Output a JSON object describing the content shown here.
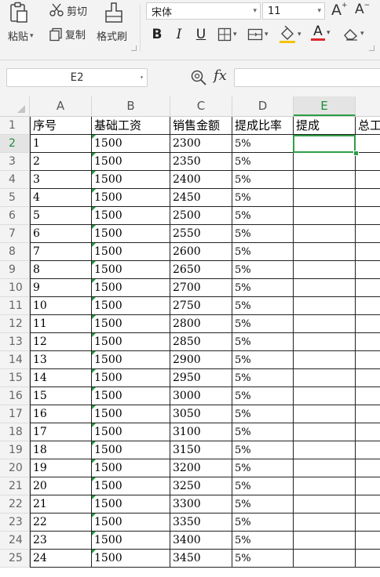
{
  "toolbar": {
    "cut_label": "剪切",
    "paste_label": "粘贴",
    "copy_label": "复制",
    "format_painter_label": "格式刷",
    "font_name": "宋体",
    "font_size": "11",
    "bold_label": "B",
    "italic_label": "I",
    "underline_label": "U",
    "grow_font_label": "A",
    "shrink_font_label": "A",
    "font_color_label": "A",
    "accent_color": "#e0282e",
    "fill_color": "#f2c300"
  },
  "formula_bar": {
    "name_box": "E2",
    "fx_label": "fx",
    "formula_value": ""
  },
  "sheet": {
    "columns": [
      "A",
      "B",
      "C",
      "D",
      "E",
      ""
    ],
    "selected_column": "E",
    "selected_row": "2",
    "header_row": [
      "序号",
      "基础工资",
      "销售金额",
      "提成比率",
      "提成",
      "总工"
    ],
    "rows": [
      {
        "row": "2",
        "a": "1",
        "b": "1500",
        "c": "2300",
        "d": "5%"
      },
      {
        "row": "3",
        "a": "2",
        "b": "1500",
        "c": "2350",
        "d": "5%"
      },
      {
        "row": "4",
        "a": "3",
        "b": "1500",
        "c": "2400",
        "d": "5%"
      },
      {
        "row": "5",
        "a": "4",
        "b": "1500",
        "c": "2450",
        "d": "5%"
      },
      {
        "row": "6",
        "a": "5",
        "b": "1500",
        "c": "2500",
        "d": "5%"
      },
      {
        "row": "7",
        "a": "6",
        "b": "1500",
        "c": "2550",
        "d": "5%"
      },
      {
        "row": "8",
        "a": "7",
        "b": "1500",
        "c": "2600",
        "d": "5%"
      },
      {
        "row": "9",
        "a": "8",
        "b": "1500",
        "c": "2650",
        "d": "5%"
      },
      {
        "row": "10",
        "a": "9",
        "b": "1500",
        "c": "2700",
        "d": "5%"
      },
      {
        "row": "11",
        "a": "10",
        "b": "1500",
        "c": "2750",
        "d": "5%"
      },
      {
        "row": "12",
        "a": "11",
        "b": "1500",
        "c": "2800",
        "d": "5%"
      },
      {
        "row": "13",
        "a": "12",
        "b": "1500",
        "c": "2850",
        "d": "5%"
      },
      {
        "row": "14",
        "a": "13",
        "b": "1500",
        "c": "2900",
        "d": "5%"
      },
      {
        "row": "15",
        "a": "14",
        "b": "1500",
        "c": "2950",
        "d": "5%"
      },
      {
        "row": "16",
        "a": "15",
        "b": "1500",
        "c": "3000",
        "d": "5%"
      },
      {
        "row": "17",
        "a": "16",
        "b": "1500",
        "c": "3050",
        "d": "5%"
      },
      {
        "row": "18",
        "a": "17",
        "b": "1500",
        "c": "3100",
        "d": "5%"
      },
      {
        "row": "19",
        "a": "18",
        "b": "1500",
        "c": "3150",
        "d": "5%"
      },
      {
        "row": "20",
        "a": "19",
        "b": "1500",
        "c": "3200",
        "d": "5%"
      },
      {
        "row": "21",
        "a": "20",
        "b": "1500",
        "c": "3250",
        "d": "5%"
      },
      {
        "row": "22",
        "a": "21",
        "b": "1500",
        "c": "3300",
        "d": "5%"
      },
      {
        "row": "23",
        "a": "22",
        "b": "1500",
        "c": "3350",
        "d": "5%"
      },
      {
        "row": "24",
        "a": "23",
        "b": "1500",
        "c": "3400",
        "d": "5%"
      },
      {
        "row": "25",
        "a": "24",
        "b": "1500",
        "c": "3450",
        "d": "5%"
      }
    ]
  }
}
